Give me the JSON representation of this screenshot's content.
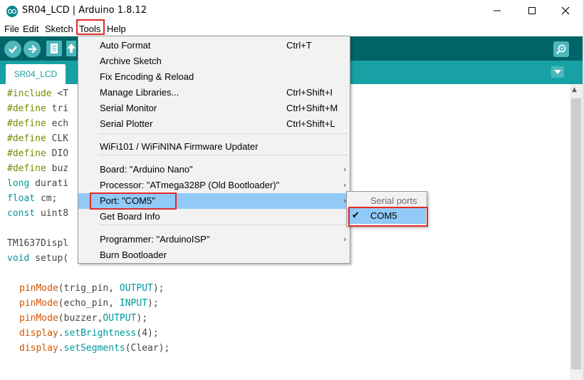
{
  "window": {
    "title": "SR04_LCD | Arduino 1.8.12",
    "min_icon": "minimize-icon",
    "max_icon": "maximize-icon",
    "close_icon": "close-icon"
  },
  "menubar": {
    "items": [
      "File",
      "Edit",
      "Sketch",
      "Tools",
      "Help"
    ],
    "active": "Tools"
  },
  "toolbar": {
    "buttons": [
      "verify-icon",
      "upload-icon",
      "new-icon",
      "open-icon"
    ],
    "serial_monitor_icon": "serial-monitor-icon"
  },
  "tabs": {
    "active": "SR04_LCD",
    "menu_icon": "tab-menu-icon"
  },
  "editor": {
    "lines": [
      {
        "kw": "#include",
        "rest": " <T"
      },
      {
        "kw": "#define",
        "rest": " tri"
      },
      {
        "kw": "#define",
        "rest": " ech"
      },
      {
        "kw": "#define",
        "rest": " CLK"
      },
      {
        "kw": "#define",
        "rest": " DIO"
      },
      {
        "kw": "#define",
        "rest": " buz"
      },
      {
        "kw": "long",
        "rest": " durati"
      },
      {
        "kw": "float",
        "rest": " cm;"
      },
      {
        "kw": "const",
        "rest": " uint8"
      },
      {
        "kw": "",
        "rest": ""
      },
      {
        "kw": "",
        "rest": "TM1637Displ"
      },
      {
        "kw": "void",
        "rest": " setup("
      }
    ],
    "body_lines": [
      {
        "fn": "pinMode",
        "a": "(trig_pin, ",
        "c": "OUTPUT",
        "z": ");"
      },
      {
        "fn": "pinMode",
        "a": "(echo_pin, ",
        "c": "INPUT",
        "z": ");"
      },
      {
        "fn": "pinMode",
        "a": "(buzzer,",
        "c": "OUTPUT",
        "z": ");"
      },
      {
        "fn": "display",
        "a": ".",
        "c": "setBrightness",
        "z": "(4);"
      },
      {
        "fn": "display",
        "a": ".",
        "c": "setSegments",
        "z": "(Clear);"
      }
    ]
  },
  "tools_menu": {
    "items": [
      {
        "label": "Auto Format",
        "shortcut": "Ctrl+T"
      },
      {
        "label": "Archive Sketch",
        "shortcut": ""
      },
      {
        "label": "Fix Encoding & Reload",
        "shortcut": ""
      },
      {
        "label": "Manage Libraries...",
        "shortcut": "Ctrl+Shift+I"
      },
      {
        "label": "Serial Monitor",
        "shortcut": "Ctrl+Shift+M"
      },
      {
        "label": "Serial Plotter",
        "shortcut": "Ctrl+Shift+L"
      },
      {
        "label": "WiFi101 / WiFiNINA Firmware Updater",
        "shortcut": ""
      },
      {
        "label": "Board: \"Arduino Nano\"",
        "shortcut": ""
      },
      {
        "label": "Processor: \"ATmega328P (Old Bootloader)\"",
        "shortcut": ""
      },
      {
        "label": "Port: \"COM5\"",
        "shortcut": ""
      },
      {
        "label": "Get Board Info",
        "shortcut": ""
      },
      {
        "label": "Programmer: \"ArduinoISP\"",
        "shortcut": ""
      },
      {
        "label": "Burn Bootloader",
        "shortcut": ""
      }
    ]
  },
  "port_submenu": {
    "header": "Serial ports",
    "items": [
      {
        "label": "COM5",
        "checked": true
      }
    ]
  },
  "colors": {
    "toolbar": "#006468",
    "tabbar": "#17a1a5",
    "highlight": "#91c9f7",
    "callout": "#e32a26"
  }
}
